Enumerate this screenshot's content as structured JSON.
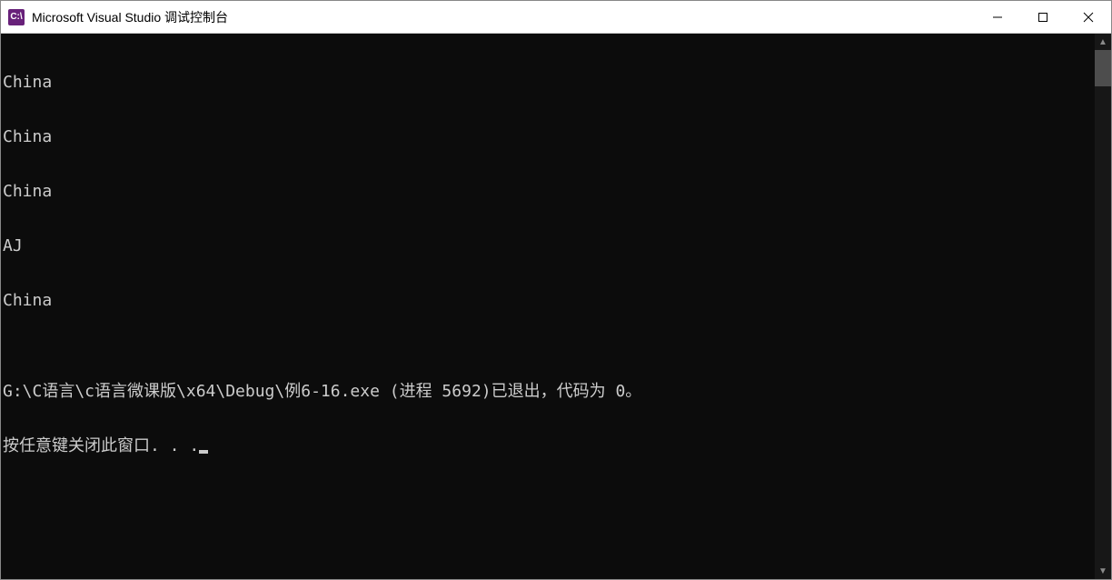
{
  "window": {
    "appIconText": "C:\\",
    "title": "Microsoft Visual Studio 调试控制台"
  },
  "console": {
    "lines": [
      "China",
      "China",
      "China",
      "AJ",
      "China",
      "",
      "G:\\C语言\\c语言微课版\\x64\\Debug\\例6-16.exe (进程 5692)已退出，代码为 0。"
    ],
    "promptLine": "按任意键关闭此窗口. . ."
  }
}
